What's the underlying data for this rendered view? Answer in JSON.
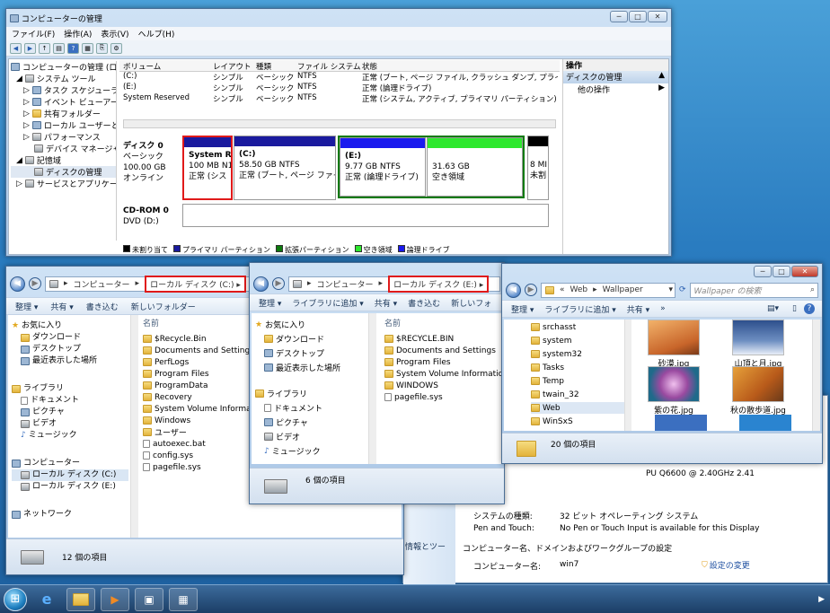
{
  "cm": {
    "title": "コンピューターの管理",
    "menu": [
      "ファイル(F)",
      "操作(A)",
      "表示(V)",
      "ヘルプ(H)"
    ],
    "tree": [
      "コンピューターの管理 (ローカ",
      "システム ツール",
      "タスク スケジューラ",
      "イベント ビューアー",
      "共有フォルダー",
      "ローカル ユーザーとグ",
      "パフォーマンス",
      "デバイス マネージャー",
      "記憶域",
      "ディスクの管理",
      "サービスとアプリケーショ"
    ],
    "columns": [
      "ボリューム",
      "レイアウト",
      "種類",
      "ファイル システム",
      "状態"
    ],
    "volumes": [
      {
        "name": "(C:)",
        "layout": "シンプル",
        "type": "ベーシック",
        "fs": "NTFS",
        "status": "正常 (ブート, ページ ファイル, クラッシュ ダンプ, プライマリ"
      },
      {
        "name": "(E:)",
        "layout": "シンプル",
        "type": "ベーシック",
        "fs": "NTFS",
        "status": "正常 (論理ドライブ)"
      },
      {
        "name": "System Reserved",
        "layout": "シンプル",
        "type": "ベーシック",
        "fs": "NTFS",
        "status": "正常 (システム, アクティブ, プライマリ パーティション)"
      }
    ],
    "disk0": {
      "name": "ディスク 0",
      "type": "ベーシック",
      "size": "100.00 GB",
      "state": "オンライン"
    },
    "partitions": [
      {
        "title": "System Re",
        "size": "100 MB N1",
        "state": "正常 (シス"
      },
      {
        "title": "(C:)",
        "size": "58.50 GB NTFS",
        "state": "正常 (ブート, ページ ファイル,"
      },
      {
        "title": "(E:)",
        "size": "9.77 GB NTFS",
        "state": "正常 (論理ドライブ)"
      },
      {
        "title": "",
        "size": "31.63 GB",
        "state": "空き領域"
      },
      {
        "title": "",
        "size": "8 MI",
        "state": "未割"
      }
    ],
    "cdrom": {
      "name": "CD-ROM 0",
      "drive": "DVD (D:)"
    },
    "legend": [
      "未割り当て",
      "プライマリ パーティション",
      "拡張パーティション",
      "空き領域",
      "論理ドライブ"
    ],
    "legend_colors": [
      "#000000",
      "#1a1a9e",
      "#0d7a0d",
      "#2ee82e",
      "#1a1aee"
    ],
    "actions_header": "操作",
    "actions_section": "ディスクの管理",
    "actions_item": "他の操作"
  },
  "exc": {
    "breadcrumb": "コンピューター",
    "location": "ローカル ディスク (C:)",
    "commands": [
      "整理 ▾",
      "共有 ▾",
      "書き込む",
      "新しいフォルダー"
    ],
    "nav": [
      "お気に入り",
      "ダウンロード",
      "デスクトップ",
      "最近表示した場所",
      "ライブラリ",
      "ドキュメント",
      "ピクチャ",
      "ビデオ",
      "ミュージック",
      "コンピューター",
      "ローカル ディスク (C:)",
      "ローカル ディスク (E:)",
      "ネットワーク"
    ],
    "col_name": "名前",
    "files": [
      "$Recycle.Bin",
      "Documents and Settings",
      "PerfLogs",
      "Program Files",
      "ProgramData",
      "Recovery",
      "System Volume Information",
      "Windows",
      "ユーザー",
      "autoexec.bat",
      "config.sys",
      "pagefile.sys"
    ],
    "status": "12 個の項目"
  },
  "exe": {
    "breadcrumb": "コンピューター",
    "location": "ローカル ディスク (E:)",
    "commands": [
      "整理 ▾",
      "ライブラリに追加 ▾",
      "共有 ▾",
      "書き込む",
      "新しいフォ"
    ],
    "nav": [
      "お気に入り",
      "ダウンロード",
      "デスクトップ",
      "最近表示した場所",
      "ライブラリ",
      "ドキュメント",
      "ピクチャ",
      "ビデオ",
      "ミュージック"
    ],
    "col_name": "名前",
    "files": [
      "$RECYCLE.BIN",
      "Documents and Settings",
      "Program Files",
      "System Volume Information",
      "WINDOWS",
      "pagefile.sys"
    ],
    "status": "6 個の項目"
  },
  "exw": {
    "breadcrumb": [
      "«",
      "Web",
      "Wallpaper"
    ],
    "search_placeholder": "Wallpaper の検索",
    "commands": [
      "整理 ▾",
      "ライブラリに追加 ▾",
      "共有 ▾",
      "»"
    ],
    "folders": [
      "srchasst",
      "system",
      "system32",
      "Tasks",
      "Temp",
      "twain_32",
      "Web",
      "WinSxS"
    ],
    "thumbs": [
      {
        "label": "砂漠.jpg",
        "color": "#d9803a"
      },
      {
        "label": "山頂と月.jpg",
        "color": "#3b5f9e"
      },
      {
        "label": "紫の花.jpg",
        "color": "#8a3f8c"
      },
      {
        "label": "秋の散歩道.jpg",
        "color": "#d97a22"
      }
    ],
    "status": "20 個の項目"
  },
  "sysinfo": {
    "cpu": "PU   Q6600  @ 2.40GHz   2.41",
    "rows": [
      {
        "k": "システムの種類:",
        "v": "32 ビット オペレーティング システム"
      },
      {
        "k": "Pen and Touch:",
        "v": "No Pen or Touch Input is available for this Display"
      }
    ],
    "section": "コンピューター名、ドメインおよびワークグループの設定",
    "comp_key": "コンピューター名:",
    "comp_val": "win7",
    "change": "設定の変更",
    "side": "情報とツー"
  },
  "taskbar": {
    "tray": "▶"
  }
}
